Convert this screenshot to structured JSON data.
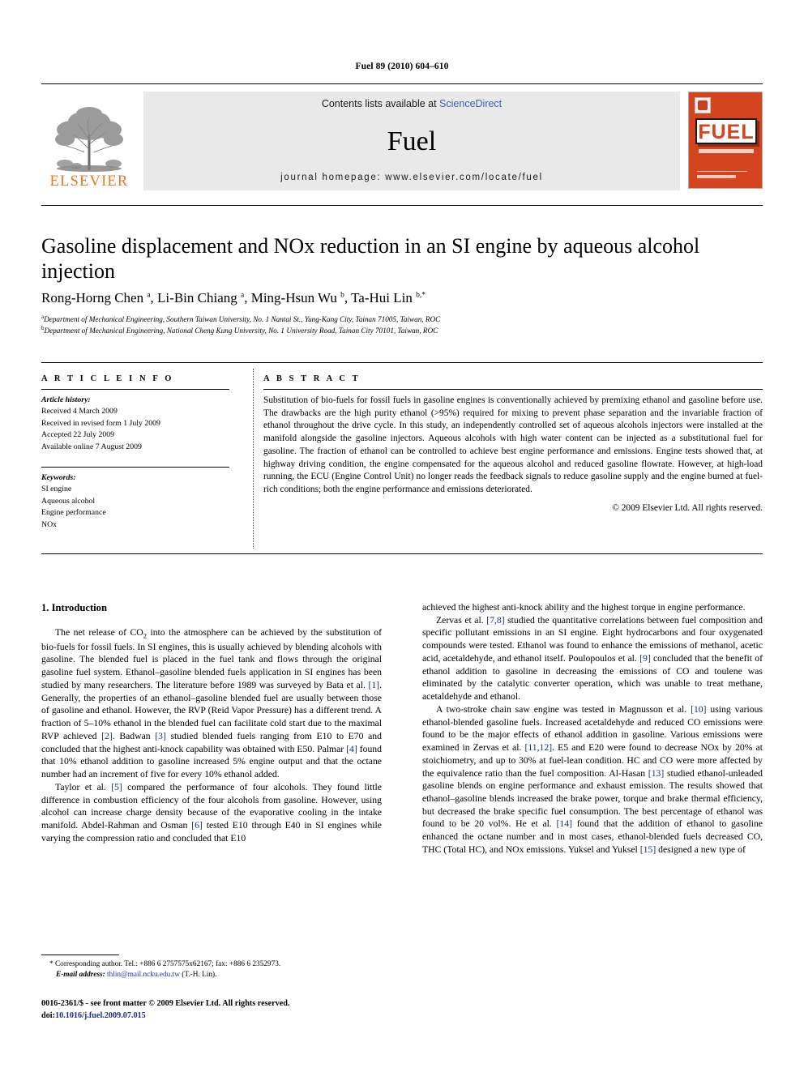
{
  "running_head": "Fuel 89 (2010) 604–610",
  "masthead": {
    "contents_prefix": "Contents lists available at ",
    "sciencedirect": "ScienceDirect",
    "journal_title": "Fuel",
    "homepage": "journal homepage: www.elsevier.com/locate/fuel",
    "publisher_name": "ELSEVIER",
    "cover_word": "FUEL",
    "logo_icons": {
      "tree": "elsevier-tree-icon",
      "cover": "fuel-cover-thumbnail"
    }
  },
  "article": {
    "title": "Gasoline displacement and NOx reduction in an SI engine by aqueous alcohol injection",
    "authors_html": "Rong-Horng Chen <sup>a</sup>, Li-Bin Chiang <sup>a</sup>, Ming-Hsun Wu <sup>b</sup>, Ta-Hui Lin <sup>b,*</sup>",
    "affiliation_a": "Department of Mechanical Engineering, Southern Taiwan University, No. 1 Nantai St., Yung-Kang City, Tainan 71005, Taiwan, ROC",
    "affiliation_b": "Department of Mechanical Engineering, National Cheng Kung University, No. 1 University Road, Tainan City 70101, Taiwan, ROC"
  },
  "article_info": {
    "heading": "A R T I C L E   I N F O",
    "history_label": "Article history:",
    "history": [
      "Received 4 March 2009",
      "Received in revised form 1 July 2009",
      "Accepted 22 July 2009",
      "Available online 7 August 2009"
    ],
    "keywords_label": "Keywords:",
    "keywords": [
      "SI engine",
      "Aqueous alcohol",
      "Engine performance",
      "NOx"
    ]
  },
  "abstract": {
    "heading": "A B S T R A C T",
    "body": "Substitution of bio-fuels for fossil fuels in gasoline engines is conventionally achieved by premixing ethanol and gasoline before use. The drawbacks are the high purity ethanol (>95%) required for mixing to prevent phase separation and the invariable fraction of ethanol throughout the drive cycle. In this study, an independently controlled set of aqueous alcohols injectors were installed at the manifold alongside the gasoline injectors. Aqueous alcohols with high water content can be injected as a substitutional fuel for gasoline. The fraction of ethanol can be controlled to achieve best engine performance and emissions. Engine tests showed that, at highway driving condition, the engine compensated for the aqueous alcohol and reduced gasoline flowrate. However, at high-load running, the ECU (Engine Control Unit) no longer reads the feedback signals to reduce gasoline supply and the engine burned at fuel-rich conditions; both the engine performance and emissions deteriorated.",
    "copyright": "© 2009 Elsevier Ltd. All rights reserved."
  },
  "body": {
    "section_heading": "1. Introduction",
    "left_paragraph_1_pre": "The net release of CO",
    "left_paragraph_1_sub": "2",
    "left_paragraph_1_post": " into the atmosphere can be achieved by the substitution of bio-fuels for fossil fuels. In SI engines, this is usually achieved by blending alcohols with gasoline. The blended fuel is placed in the fuel tank and flows through the original gasoline fuel system. Ethanol–gasoline blended fuels application in SI engines has been studied by many researchers. The literature before 1989 was surveyed by Bata et al. ",
    "ref_1": "[1]",
    "left_p1_tail_a": ". Generally, the properties of an ethanol–gasoline blended fuel are usually between those of gasoline and ethanol. However, the RVP (Reid Vapor Pressure) has a different trend. A fraction of 5–10% ethanol in the blended fuel can facilitate cold start due to the maximal RVP achieved ",
    "ref_2": "[2]",
    "left_p1_tail_b": ". Badwan ",
    "ref_3": "[3]",
    "left_p1_tail_c": " studied blended fuels ranging from E10 to E70 and concluded that the highest anti-knock capability was obtained with E50. Palmar ",
    "ref_4": "[4]",
    "left_p1_tail_d": " found that 10% ethanol addition to gasoline increased 5% engine output and that the octane number had an increment of five for every 10% ethanol added.",
    "left_p2_a": "Taylor et al. ",
    "ref_5": "[5]",
    "left_p2_b": " compared the performance of four alcohols. They found little difference in combustion efficiency of the four alcohols from gasoline. However, using alcohol can increase charge density because of the evaporative cooling in the intake manifold. Abdel-Rahman and Osman ",
    "ref_6": "[6]",
    "left_p2_c": " tested E10 through E40 in SI engines while varying the compression ratio and concluded that E10",
    "right_p1": "achieved the highest anti-knock ability and the highest torque in engine performance.",
    "right_p2_a": "Zervas et al. ",
    "ref_78": "[7,8]",
    "right_p2_b": " studied the quantitative correlations between fuel composition and specific pollutant emissions in an SI engine. Eight hydrocarbons and four oxygenated compounds were tested. Ethanol was found to enhance the emissions of methanol, acetic acid, acetaldehyde, and ethanol itself. Poulopoulos et al. ",
    "ref_9": "[9]",
    "right_p2_c": " concluded that the benefit of ethanol addition to gasoline in decreasing the emissions of CO and toulene was eliminated by the catalytic converter operation, which was unable to treat methane, acetaldehyde and ethanol.",
    "right_p3_a": "A two-stroke chain saw engine was tested in Magnusson et al. ",
    "ref_10": "[10]",
    "right_p3_b": " using various ethanol-blended gasoline fuels. Increased acetaldehyde and reduced CO emissions were found to be the major effects of ethanol addition in gasoline. Various emissions were examined in Zervas et al. ",
    "ref_1112": "[11,12]",
    "right_p3_c": ". E5 and E20 were found to decrease NOx by 20% at stoichiometry, and up to 30% at fuel-lean condition. HC and CO were more affected by the equivalence ratio than the fuel composition. Al-Hasan ",
    "ref_13": "[13]",
    "right_p3_d": " studied ethanol-unleaded gasoline blends on engine performance and exhaust emission. The results showed that ethanol–gasoline blends increased the brake power, torque and brake thermal efficiency, but decreased the brake specific fuel consumption. The best percentage of ethanol was found to be 20 vol%. He et al. ",
    "ref_14": "[14]",
    "right_p3_e": " found that the addition of ethanol to gasoline enhanced the octane number and in most cases, ethanol-blended fuels decreased CO, THC (Total HC), and NOx emissions. Yuksel and Yuksel ",
    "ref_15": "[15]",
    "right_p3_f": " designed a new type of"
  },
  "footnote": {
    "marker": "*",
    "corresponding": "Corresponding author. Tel.: +886 6 2757575x62167; fax: +886 6 2352973.",
    "email_label": "E-mail address:",
    "email": "thlin@mail.ncku.edu.tw",
    "email_owner": "(T.-H. Lin)."
  },
  "footer": {
    "issn_line": "0016-2361/$ - see front matter © 2009 Elsevier Ltd. All rights reserved.",
    "doi_label": "doi:",
    "doi": "10.1016/j.fuel.2009.07.015"
  },
  "colors": {
    "elsevier_orange": "#E87722",
    "sciencedirect_blue": "#3b5fc0",
    "reference_blue": "#1a2f87",
    "cover_red": "#d4451f",
    "band_gray": "#e9e9e9"
  }
}
